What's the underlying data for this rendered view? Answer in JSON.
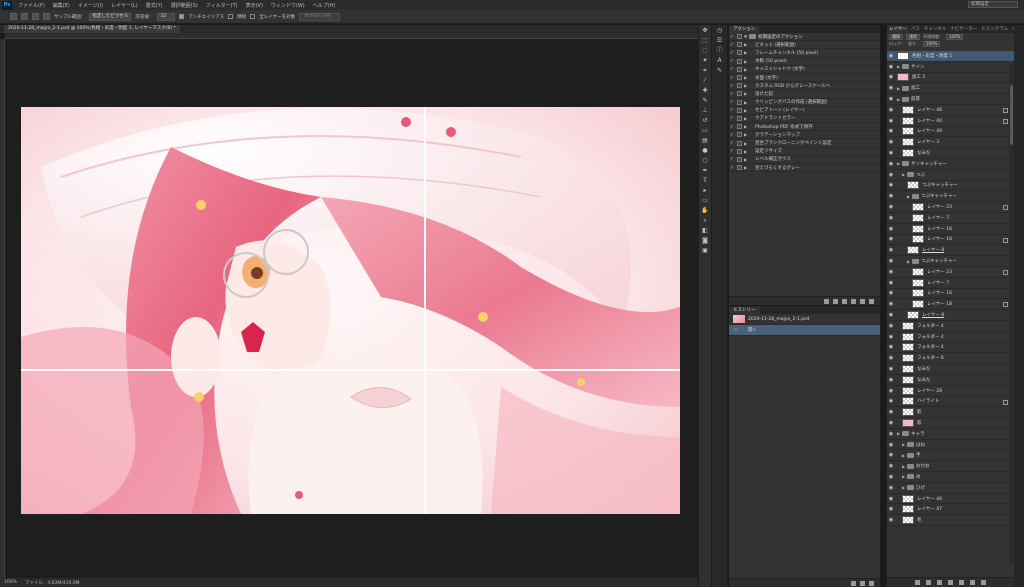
{
  "app": {
    "logo": "Ps"
  },
  "menu": [
    "ファイル(F)",
    "編集(E)",
    "イメージ(I)",
    "レイヤー(L)",
    "書式(Y)",
    "選択範囲(S)",
    "フィルター(T)",
    "表示(V)",
    "ウィンドウ(W)",
    "ヘルプ(H)"
  ],
  "workspace_label": "初期設定",
  "options": {
    "sample_label": "サンプル範囲：",
    "sample_value": "指定したピクセル",
    "tolerance_label": "許容値：",
    "tolerance_value": "32",
    "antialias_label": "アンチエイリアス",
    "contiguous_label": "隣接",
    "all_layers_label": "全レイヤーを対象",
    "refine_edge_label": "境界線を調整..."
  },
  "document": {
    "tab_title": "2020-11-28_majyo_2-1.psd @ 100%(色相・彩度・明度 1, レイヤーマスク/8) *",
    "zoom": "100%",
    "file_info": "ファイル：4.63M/410.0M"
  },
  "actions_panel": {
    "tabs": [
      "アクション"
    ],
    "items": [
      {
        "label": "初期設定のアクション",
        "folder": true
      },
      {
        "label": "ビネット (選択範囲)"
      },
      {
        "label": "フレームチャンネル (50 pixel)"
      },
      {
        "label": "木製 (50 pixel)"
      },
      {
        "label": "キャストシャドウ (文字)"
      },
      {
        "label": "水面 (文字)"
      },
      {
        "label": "カスタム RGB からグレースケールへ"
      },
      {
        "label": "溶けた鉛"
      },
      {
        "label": "クリッピングパスの作成 (選択範囲)"
      },
      {
        "label": "セピアトーン (レイヤー)"
      },
      {
        "label": "クアドラントカラー"
      },
      {
        "label": "Photoshop PDF 形式で保存"
      },
      {
        "label": "グラデーションマップ"
      },
      {
        "label": "混合ブラシクローニングペイント設定"
      },
      {
        "label": "設定リサイズ"
      },
      {
        "label": "レベル補正ガウス"
      },
      {
        "label": "見えづらくするグレー"
      }
    ]
  },
  "history_panel": {
    "tab": "ヒストリー",
    "items": [
      {
        "label": "2020-11-28_majyo_2-1.psd",
        "snapshot": true
      },
      {
        "label": "開く",
        "selected": true
      }
    ]
  },
  "layers_panel": {
    "tabs": [
      "レイヤー",
      "パス",
      "チャンネル",
      "ナビゲーター",
      "ヒストグラム",
      "カラー",
      "スウォッチ"
    ],
    "kind_label": "種類",
    "blend_mode": "通常",
    "opacity_label": "不透明度：",
    "opacity_value": "100%",
    "lock_label": "ロック：",
    "fill_label": "塗り：",
    "fill_value": "100%",
    "layers": [
      {
        "name": "色相・彩度・明度 1",
        "thumb": "white",
        "selected": true,
        "indent": 0
      },
      {
        "name": "サイン",
        "folder": true,
        "indent": 0
      },
      {
        "name": "加工 2",
        "thumb": "pink",
        "indent": 0
      },
      {
        "name": "加工",
        "folder": true,
        "indent": 0
      },
      {
        "name": "前景",
        "folder": true,
        "indent": 0
      },
      {
        "name": "レイヤー 48",
        "indent": 1,
        "fx": true
      },
      {
        "name": "レイヤー 40",
        "indent": 1,
        "fx": true
      },
      {
        "name": "レイヤー 49",
        "indent": 1
      },
      {
        "name": "レイヤー 3",
        "indent": 1
      },
      {
        "name": "なみだ",
        "indent": 1
      },
      {
        "name": "サンキャッチャー",
        "folder": true,
        "indent": 0
      },
      {
        "name": "つぶ",
        "folder": true,
        "indent": 1
      },
      {
        "name": "つぶキャッチャー",
        "indent": 2
      },
      {
        "name": "つぶキャッチャー",
        "folder": true,
        "indent": 2
      },
      {
        "name": "レイヤー 23",
        "indent": 3,
        "lock": true
      },
      {
        "name": "レイヤー 7",
        "indent": 3
      },
      {
        "name": "レイヤー 16",
        "indent": 3
      },
      {
        "name": "レイヤー 18",
        "indent": 3,
        "fx": true
      },
      {
        "name": "レイヤー 8",
        "indent": 2,
        "link": true
      },
      {
        "name": "つぶキャッチャー",
        "folder": true,
        "indent": 2
      },
      {
        "name": "レイヤー 23",
        "indent": 3,
        "lock": true
      },
      {
        "name": "レイヤー 7",
        "indent": 3
      },
      {
        "name": "レイヤー 16",
        "indent": 3
      },
      {
        "name": "レイヤー 18",
        "indent": 3,
        "fx": true
      },
      {
        "name": "レイヤー 8",
        "indent": 2,
        "link": true
      },
      {
        "name": "フォルダー 4",
        "indent": 1
      },
      {
        "name": "フォルダー 4",
        "indent": 1
      },
      {
        "name": "フォルダー 4",
        "indent": 1
      },
      {
        "name": "フォルダー 6",
        "indent": 1
      },
      {
        "name": "なみだ",
        "indent": 1
      },
      {
        "name": "なみだ",
        "indent": 1
      },
      {
        "name": "レイヤー 28",
        "indent": 1
      },
      {
        "name": "ハイライト",
        "indent": 1,
        "fx": true
      },
      {
        "name": "影",
        "indent": 1
      },
      {
        "name": "影",
        "thumb": "pink",
        "indent": 1
      },
      {
        "name": "キャラ",
        "folder": true,
        "indent": 0
      },
      {
        "name": "はね",
        "folder": true,
        "indent": 1
      },
      {
        "name": "手",
        "folder": true,
        "indent": 1
      },
      {
        "name": "おかお",
        "folder": true,
        "indent": 1
      },
      {
        "name": "め",
        "folder": true,
        "indent": 1
      },
      {
        "name": "ひげ",
        "folder": true,
        "indent": 1
      },
      {
        "name": "レイヤー 46",
        "indent": 1
      },
      {
        "name": "レイヤー 47",
        "indent": 1
      },
      {
        "name": "毛",
        "indent": 1
      }
    ]
  },
  "colors": {
    "accent": "#31a8ff",
    "selection": "#415a74",
    "artwork_pink": "#e8708a"
  }
}
